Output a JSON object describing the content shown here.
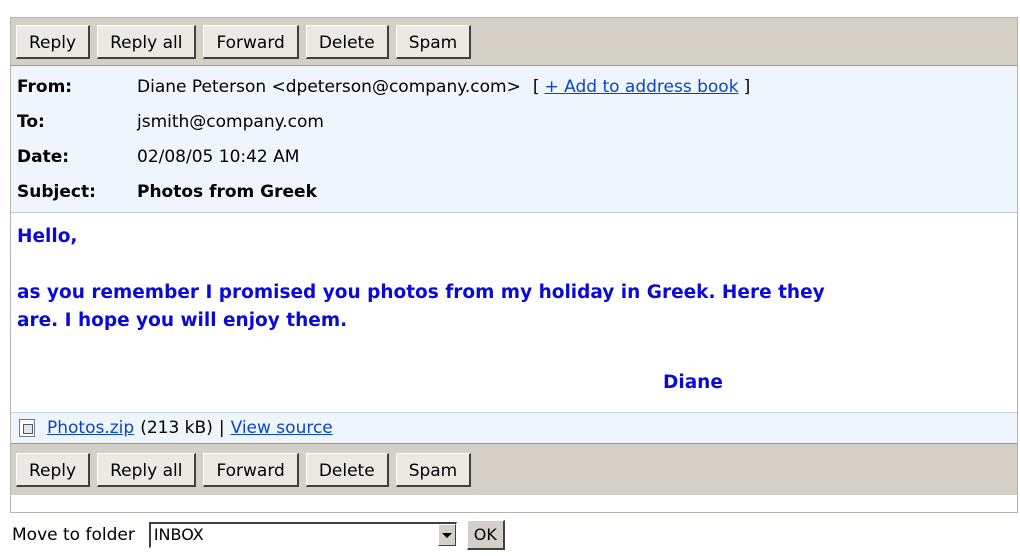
{
  "toolbar": {
    "reply": "Reply",
    "reply_all": "Reply all",
    "forward": "Forward",
    "delete": "Delete",
    "spam": "Spam"
  },
  "headers": {
    "from_label": "From:",
    "from_value": "Diane Peterson <dpeterson@company.com>",
    "bracket_open": "[",
    "add_to_address_book": "+ Add to address book",
    "bracket_close": "]",
    "to_label": "To:",
    "to_value": "jsmith@company.com",
    "date_label": "Date:",
    "date_value": "02/08/05 10:42 AM",
    "subject_label": "Subject:",
    "subject_value": "Photos from Greek"
  },
  "body": {
    "greeting": "Hello,",
    "line1": "as you remember I promised you photos from my holiday in Greek. Here they",
    "line2": "are. I hope you will enjoy them.",
    "signature": "Diane"
  },
  "attachment": {
    "icon": "zip-file-icon",
    "filename": "Photos.zip",
    "size": "(213 kB)",
    "separator": "|",
    "view_source": "View source"
  },
  "move": {
    "label": "Move to folder",
    "selected_folder": "INBOX",
    "ok": "OK"
  },
  "colors": {
    "toolbar_bg": "#d4d0c8",
    "header_bg": "#eef5fc",
    "body_text": "#0a0ad8",
    "link": "#0a45c8"
  }
}
